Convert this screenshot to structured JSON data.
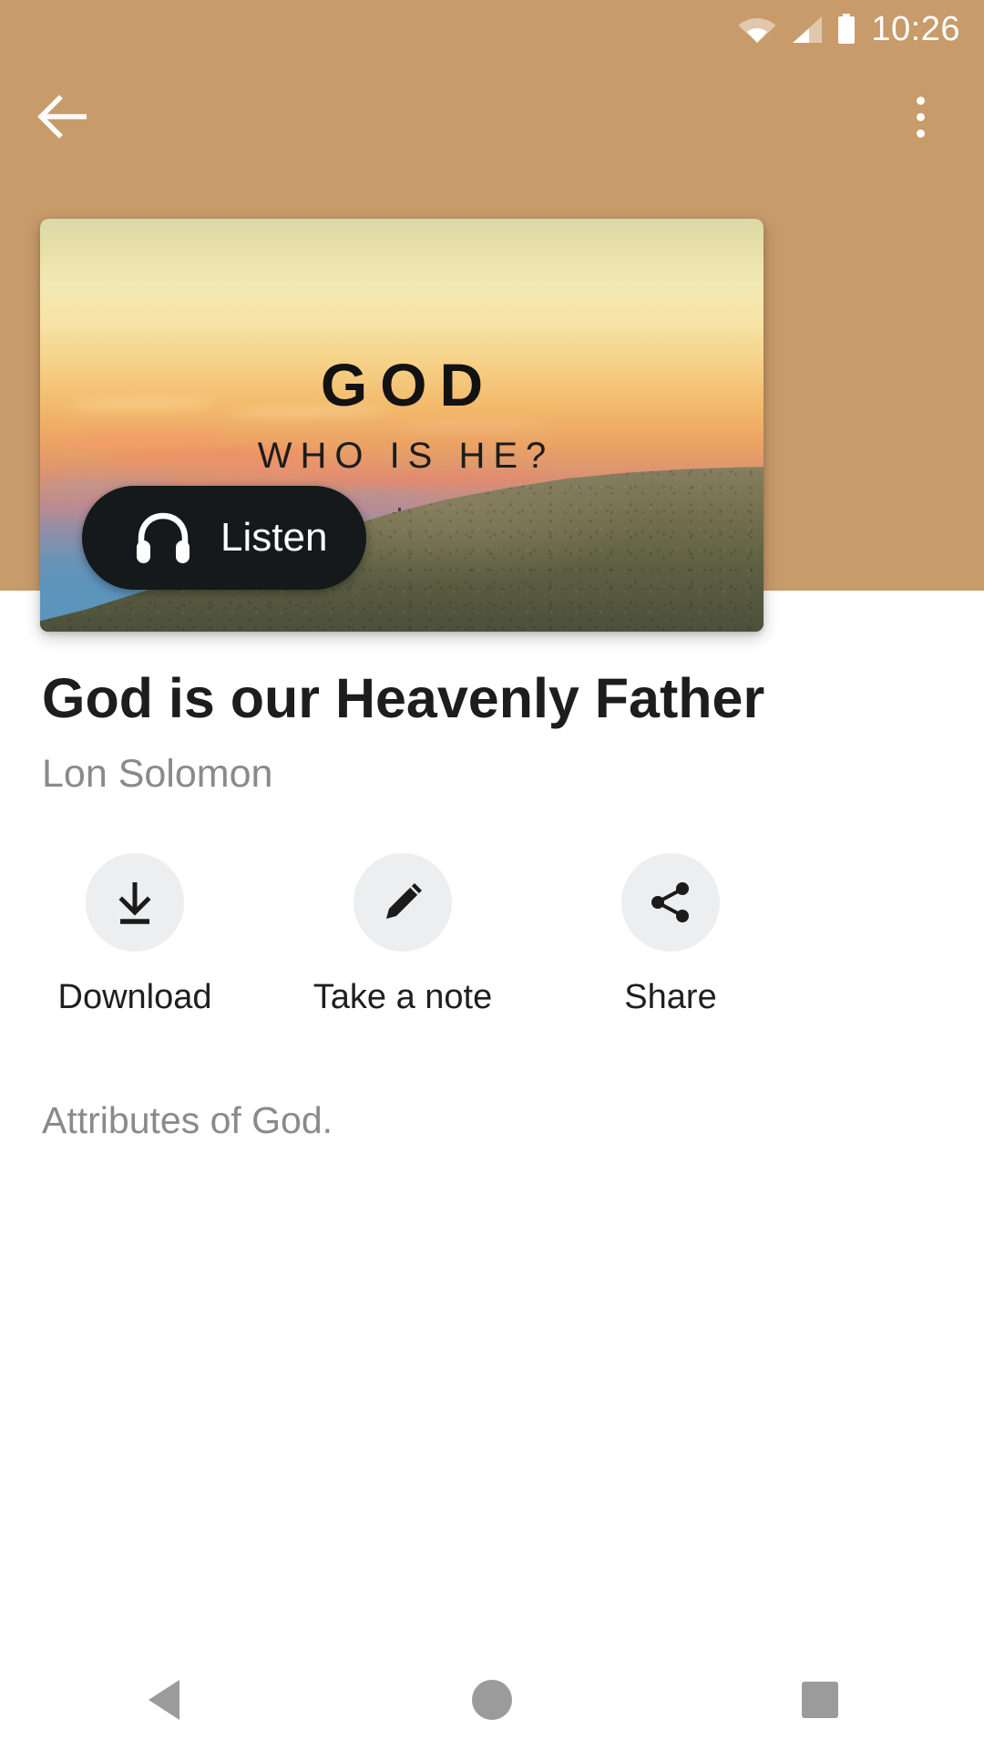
{
  "status_bar": {
    "time": "10:26",
    "icons": [
      "wifi-icon",
      "cellular-signal-icon",
      "battery-icon"
    ]
  },
  "app_bar": {
    "back_icon": "arrow-left-icon",
    "overflow_icon": "more-vertical-icon",
    "background_color": "#c89b6b"
  },
  "hero": {
    "title": "GOD",
    "subtitle": "WHO IS HE?",
    "listen_label": "Listen",
    "listen_icon": "headphones-icon",
    "listen_bg_color": "#15191c"
  },
  "sermon": {
    "title": "God is our Heavenly Father",
    "speaker": "Lon Solomon",
    "description": "Attributes of God."
  },
  "actions": [
    {
      "label": "Download",
      "icon": "download-icon"
    },
    {
      "label": "Take a note",
      "icon": "pencil-icon"
    },
    {
      "label": "Share",
      "icon": "share-icon"
    }
  ],
  "nav_bar": {
    "back": "nav-back-icon",
    "home": "nav-home-icon",
    "recents": "nav-recents-icon"
  }
}
